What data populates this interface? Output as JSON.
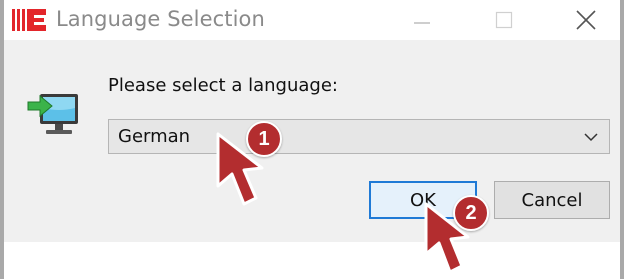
{
  "window": {
    "title": "Language Selection",
    "controls": {
      "minimize": "minimize-icon",
      "maximize": "maximize-icon",
      "close": "close-icon"
    }
  },
  "dialog": {
    "prompt": "Please select a language:",
    "language_select": {
      "selected": "German"
    },
    "buttons": {
      "ok": "OK",
      "cancel": "Cancel"
    }
  },
  "annotations": {
    "step1": "1",
    "step2": "2"
  },
  "colors": {
    "callout": "#b32d2f",
    "ok_border": "#1f7ad6",
    "client_bg": "#f0f0f0",
    "logo": "#e3262b"
  }
}
